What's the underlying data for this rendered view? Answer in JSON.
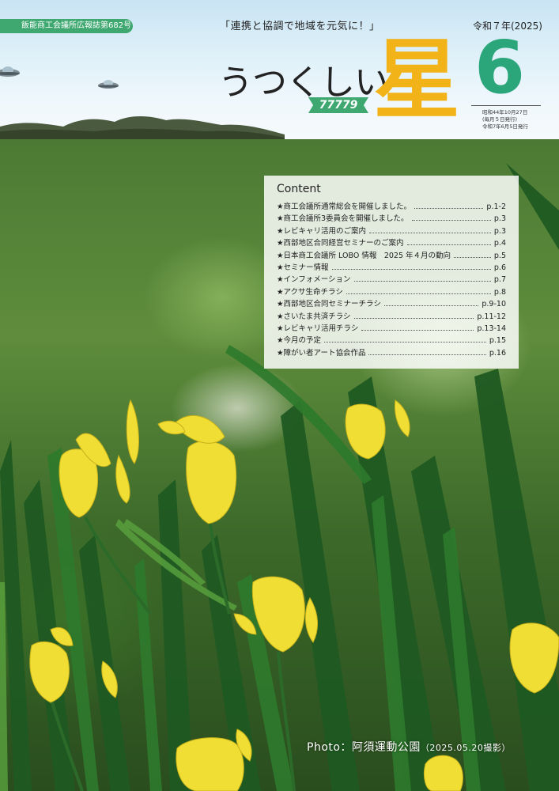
{
  "header": {
    "issue_label": "飯能商工会議所広報誌第682号",
    "slogan": "「連携と協調で地域を元気に！」",
    "year": "令和７年(2025)",
    "title_hiragana": "うつくしい",
    "title_kanji": "星",
    "ribbon_text": "77779",
    "month": "6",
    "publication": [
      "昭和44年10月27日",
      "(毎月５日発行)",
      "令和7年6月5日発行"
    ]
  },
  "contents": {
    "heading": "Content",
    "items": [
      {
        "title": "★商工会議所通常総会を開催しました。",
        "page": "p.1-2"
      },
      {
        "title": "★商工会議所3委員会を開催しました。",
        "page": "p.3"
      },
      {
        "title": "★レビキャリ活用のご案内",
        "page": "p.3"
      },
      {
        "title": "★西部地区合同経営セミナーのご案内",
        "page": "p.4"
      },
      {
        "title": "★日本商工会議所 LOBO 情報　2025 年４月の動向",
        "page": "p.5"
      },
      {
        "title": "★セミナー情報",
        "page": "p.6"
      },
      {
        "title": "★インフォメーション",
        "page": "p.7"
      },
      {
        "title": "★アクサ生命チラシ",
        "page": "p.8"
      },
      {
        "title": "★西部地区合同セミナーチラシ",
        "page": "p.9-10"
      },
      {
        "title": "★さいたま共済チラシ",
        "page": "p.11-12"
      },
      {
        "title": "★レビキャリ活用チラシ",
        "page": "p.13-14"
      },
      {
        "title": "★今月の予定",
        "page": "p.15"
      },
      {
        "title": "★障がい者アート協会作品",
        "page": "p.16"
      }
    ]
  },
  "caption": {
    "main": "Photo：阿須運動公園",
    "note": "（2025.05.20撮影）"
  },
  "colors": {
    "brand_green": "#3ea870",
    "title_gold": "#f2b318",
    "month_green": "#2ba67a"
  }
}
